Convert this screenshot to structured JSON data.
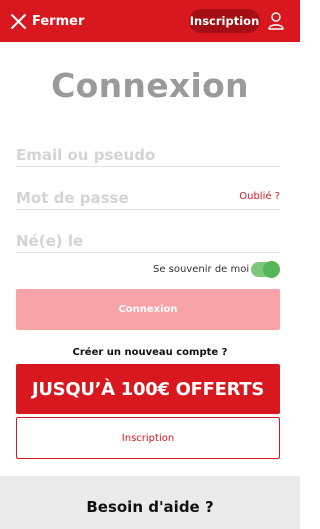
{
  "header": {
    "close_label": "Fermer",
    "signup_label": "Inscription",
    "close_icon": "close-icon",
    "user_icon": "user-icon",
    "brand_color": "#d8171e"
  },
  "page": {
    "title": "Connexion"
  },
  "form": {
    "email_placeholder": "Email ou pseudo",
    "password_placeholder": "Mot de passe",
    "forgot_label": "Oublié ?",
    "birth_placeholder": "Né(e) le",
    "remember_label": "Se souvenir de moi",
    "remember_checked": true,
    "submit_label": "Connexion"
  },
  "register": {
    "prompt": "Créer un nouveau compte ?",
    "promo_label": "JUSQU’À 100€ OFFERTS",
    "signup_label": "Inscription"
  },
  "footer": {
    "help_label": "Besoin d'aide ?"
  }
}
